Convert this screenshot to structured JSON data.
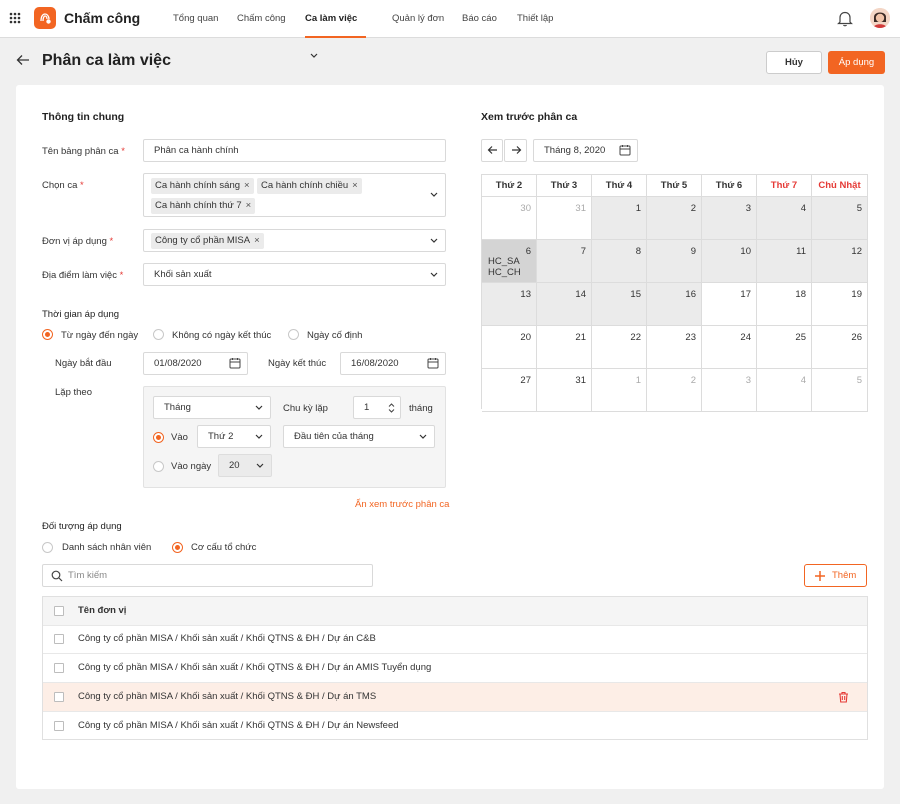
{
  "app": {
    "name": "Chấm công",
    "accent": "#f26522"
  },
  "nav": {
    "items": [
      "Tổng quan",
      "Chấm công",
      "Ca làm việc",
      "Quản lý đơn",
      "Báo cáo",
      "Thiết lập"
    ],
    "active": "Ca làm việc"
  },
  "page": {
    "title": "Phân ca làm việc",
    "cancel_label": "Hủy",
    "apply_label": "Áp dụng"
  },
  "general": {
    "section_title": "Thông tin chung",
    "table_name_label": "Tên bảng phân ca",
    "table_name_value": "Phân ca hành chính",
    "shift_label": "Chọn ca",
    "shift_tags": [
      "Ca hành chính sáng",
      "Ca hành chính chiều",
      "Ca hành chính thứ 7"
    ],
    "unit_label": "Đơn vị áp dụng",
    "unit_tags": [
      "Công ty cổ phần MISA"
    ],
    "location_label": "Địa điểm làm việc",
    "location_value": "Khối sản xuất",
    "required_mark": "*"
  },
  "time": {
    "section_title": "Thời gian áp dụng",
    "options": [
      "Từ ngày đến ngày",
      "Không có ngày kết thúc",
      "Ngày cố định"
    ],
    "selected_option": "Từ ngày đến ngày",
    "start_label": "Ngày bắt đầu",
    "start_value": "01/08/2020",
    "end_label": "Ngày kết thúc",
    "end_value": "16/08/2020",
    "repeat_label": "Lặp theo",
    "repeat": {
      "period": "Tháng",
      "cycle_label": "Chu kỳ lặp",
      "cycle_value": "1",
      "cycle_unit": "tháng",
      "on_label": "Vào",
      "on_day": "Thứ 2",
      "on_week": "Đầu tiên của tháng",
      "on_date_label": "Vào ngày",
      "on_date_value": "20",
      "selected": "Vào"
    },
    "hide_preview_link": "Ẩn xem trước phân ca"
  },
  "preview": {
    "section_title": "Xem trước phân ca",
    "month_value": "Tháng 8, 2020",
    "weekdays": [
      "Thứ 2",
      "Thứ 3",
      "Thứ 4",
      "Thứ 5",
      "Thứ 6",
      "Thứ 7",
      "Chủ Nhật"
    ],
    "weekend_color": "#e53935",
    "weeks": [
      [
        {
          "d": "30",
          "m": 1
        },
        {
          "d": "31",
          "m": 1
        },
        {
          "d": "1",
          "s": "g"
        },
        {
          "d": "2",
          "s": "g"
        },
        {
          "d": "3",
          "s": "g"
        },
        {
          "d": "4",
          "s": "g"
        },
        {
          "d": "5",
          "s": "g"
        }
      ],
      [
        {
          "d": "6",
          "s": "dg",
          "shifts": [
            "HC_SA",
            "HC_CH"
          ]
        },
        {
          "d": "7",
          "s": "g"
        },
        {
          "d": "8",
          "s": "g"
        },
        {
          "d": "9",
          "s": "g"
        },
        {
          "d": "10",
          "s": "g"
        },
        {
          "d": "11",
          "s": "g"
        },
        {
          "d": "12",
          "s": "g"
        }
      ],
      [
        {
          "d": "13",
          "s": "g"
        },
        {
          "d": "14",
          "s": "g"
        },
        {
          "d": "15",
          "s": "g"
        },
        {
          "d": "16",
          "s": "g"
        },
        {
          "d": "17"
        },
        {
          "d": "18"
        },
        {
          "d": "19"
        }
      ],
      [
        {
          "d": "20"
        },
        {
          "d": "21"
        },
        {
          "d": "22"
        },
        {
          "d": "23"
        },
        {
          "d": "24"
        },
        {
          "d": "25"
        },
        {
          "d": "26"
        }
      ],
      [
        {
          "d": "27"
        },
        {
          "d": "31"
        },
        {
          "d": "1",
          "m": 1
        },
        {
          "d": "2",
          "m": 1
        },
        {
          "d": "3",
          "m": 1
        },
        {
          "d": "4",
          "m": 1
        },
        {
          "d": "5",
          "m": 1
        }
      ]
    ]
  },
  "target": {
    "section_title": "Đối tượng áp dụng",
    "options": [
      "Danh sách nhân viên",
      "Cơ cấu tổ chức"
    ],
    "selected_option": "Cơ cấu tổ chức",
    "search_placeholder": "Tìm kiếm",
    "add_label": "Thêm",
    "column_header": "Tên đơn vị",
    "rows": [
      "Công ty cổ phần MISA / Khối sản xuất / Khối QTNS & ĐH / Dự án C&B",
      "Công ty cổ phần MISA / Khối sản xuất / Khối QTNS & ĐH / Dự án AMIS Tuyển dụng",
      "Công ty cổ phần MISA / Khối sản xuất / Khối QTNS & ĐH / Dự án TMS",
      "Công ty cổ phần MISA / Khối sản xuất / Khối QTNS & ĐH / Dự án Newsfeed"
    ],
    "highlighted_row": 2,
    "highlight_color": "#fdeee6"
  }
}
